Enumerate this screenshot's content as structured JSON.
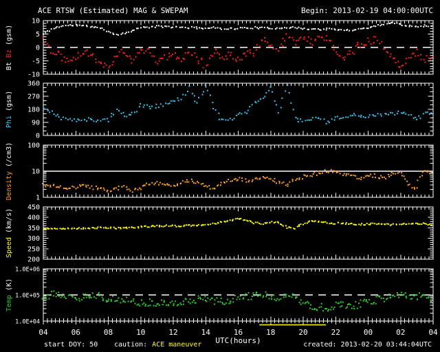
{
  "header": {
    "title": "ACE RTSW (Estimated) MAG & SWEPAM",
    "begin_label": "Begin: 2013-02-19 04:00:00UTC"
  },
  "footer": {
    "xlabel": "UTC(hours)",
    "start_doy": "start DOY: 50",
    "caution_label": "caution:",
    "caution_value": "ACE maneuver",
    "created": "created: 2013-02-20 03:44:04UTC"
  },
  "colors": {
    "background": "#000000",
    "frame": "#ffffff",
    "bt": "#ffffff",
    "bz": "#ff2020",
    "phi": "#38c9f5",
    "density": "#ffa028",
    "speed": "#ffff00",
    "temp": "#2ecc2e",
    "caution": "#ffff00"
  },
  "chart_data": {
    "type": "scatter",
    "title": "ACE RTSW (Estimated) MAG & SWEPAM",
    "begin_utc": "2013-02-19 04:00:00UTC",
    "created_utc": "2013-02-20 03:44:04UTC",
    "xlabel": "UTC(hours)",
    "x_range": [
      4,
      28
    ],
    "x_step": 0.5,
    "x_ticks": [
      {
        "value": 4,
        "label": "04"
      },
      {
        "value": 6,
        "label": "06"
      },
      {
        "value": 8,
        "label": "08"
      },
      {
        "value": 10,
        "label": "10"
      },
      {
        "value": 12,
        "label": "12"
      },
      {
        "value": 14,
        "label": "14"
      },
      {
        "value": 16,
        "label": "16"
      },
      {
        "value": 18,
        "label": "18"
      },
      {
        "value": 20,
        "label": "20"
      },
      {
        "value": 22,
        "label": "22"
      },
      {
        "value": 24,
        "label": "00"
      },
      {
        "value": 26,
        "label": "02"
      },
      {
        "value": 28,
        "label": "04"
      }
    ],
    "maneuver_span_hours": [
      17.3,
      21.4
    ],
    "panels": [
      {
        "id": "mag",
        "axis_label_parts": [
          {
            "text": "Bt",
            "color": "#ffffff"
          },
          {
            "text": "Bz",
            "color": "#ff2020"
          },
          {
            "text": "(gsm)",
            "color": "#ffffff"
          }
        ],
        "scale": "linear",
        "ylim": [
          -10,
          10
        ],
        "yticks": [
          {
            "value": 10,
            "label": "10"
          },
          {
            "value": 5,
            "label": "5"
          },
          {
            "value": 0,
            "label": "0"
          },
          {
            "value": -5,
            "label": "-5"
          },
          {
            "value": -10,
            "label": "-10"
          }
        ],
        "refline": {
          "value": 0,
          "style": "dashed"
        },
        "series": [
          {
            "name": "Bt",
            "color": "#ffffff",
            "seed": 11,
            "points_per_step": 4,
            "jitter_mode": "linear",
            "scatter_amp": 0.35,
            "values": [
              5.0,
              6.8,
              7.8,
              8.2,
              8.3,
              8.0,
              7.8,
              7.2,
              6.0,
              4.8,
              5.2,
              6.5,
              7.3,
              7.6,
              7.8,
              7.8,
              7.6,
              7.5,
              7.4,
              7.3,
              7.2,
              7.3,
              7.1,
              7.0,
              7.1,
              7.3,
              7.4,
              7.2,
              7.1,
              7.3,
              7.5,
              7.3,
              7.1,
              6.9,
              6.7,
              6.9,
              6.6,
              6.4,
              6.6,
              6.9,
              7.4,
              8.0,
              8.8,
              9.2,
              8.6,
              8.1,
              7.9,
              8.1,
              8.0
            ]
          },
          {
            "name": "Bz",
            "color": "#ff2020",
            "seed": 22,
            "points_per_step": 5,
            "jitter_mode": "linear",
            "scatter_amp": 1.4,
            "values": [
              3.5,
              -1.0,
              -2.5,
              -5.0,
              -3.0,
              -1.5,
              -3.0,
              -5.5,
              -6.5,
              -4.0,
              -1.0,
              -5.0,
              -2.0,
              -1.0,
              -6.0,
              -4.0,
              -1.5,
              -5.0,
              -1.0,
              -4.0,
              -7.0,
              -1.5,
              -4.0,
              -2.5,
              -4.0,
              -2.0,
              -2.0,
              3.0,
              1.0,
              -1.0,
              4.0,
              1.5,
              4.0,
              2.0,
              3.0,
              4.0,
              -1.0,
              -3.5,
              -2.0,
              1.0,
              2.5,
              3.0,
              0.0,
              -4.0,
              -7.0,
              -3.5,
              -1.5,
              -4.5,
              -3.5
            ]
          }
        ]
      },
      {
        "id": "phi",
        "axis_label_parts": [
          {
            "text": "Phi",
            "color": "#38c9f5"
          },
          {
            "text": "(gsm)",
            "color": "#ffffff"
          }
        ],
        "scale": "linear",
        "ylim": [
          0,
          360
        ],
        "yticks": [
          {
            "value": 360,
            "label": "360"
          },
          {
            "value": 270,
            "label": "270"
          },
          {
            "value": 180,
            "label": "180"
          },
          {
            "value": 90,
            "label": "90"
          },
          {
            "value": 0,
            "label": "0"
          }
        ],
        "refline": null,
        "series": [
          {
            "name": "Phi",
            "color": "#38c9f5",
            "seed": 33,
            "points_per_step": 4,
            "jitter_mode": "linear",
            "scatter_amp": 14,
            "values": [
              185,
              160,
              125,
              108,
              100,
              108,
              112,
              103,
              108,
              172,
              140,
              148,
              205,
              195,
              200,
              215,
              240,
              250,
              330,
              215,
              345,
              195,
              100,
              108,
              145,
              155,
              230,
              250,
              340,
              155,
              350,
              115,
              95,
              108,
              118,
              85,
              115,
              128,
              135,
              140,
              130,
              140,
              148,
              152,
              158,
              150,
              112,
              145,
              152
            ]
          }
        ]
      },
      {
        "id": "density",
        "axis_label_parts": [
          {
            "text": "Density",
            "color": "#ffa028"
          },
          {
            "text": "(/cm3)",
            "color": "#ffffff"
          }
        ],
        "scale": "log",
        "ylim": [
          1,
          100
        ],
        "yticks": [
          {
            "value": 100,
            "label": "100"
          },
          {
            "value": 10,
            "label": "10"
          },
          {
            "value": 1,
            "label": "1"
          }
        ],
        "refline": {
          "value": 10,
          "style": "solid"
        },
        "series": [
          {
            "name": "Density",
            "color": "#ffa028",
            "seed": 44,
            "points_per_step": 5,
            "jitter_mode": "log",
            "scatter_amp": 0.07,
            "values": [
              3.0,
              2.7,
              2.4,
              2.2,
              2.5,
              2.8,
              2.4,
              2.1,
              1.8,
              2.1,
              2.6,
              1.7,
              2.3,
              3.1,
              3.6,
              3.0,
              2.6,
              4.0,
              4.4,
              3.4,
              2.6,
              2.1,
              3.6,
              4.6,
              5.2,
              4.2,
              4.6,
              5.6,
              5.0,
              3.6,
              3.1,
              4.6,
              6.2,
              7.2,
              8.8,
              10.5,
              9.2,
              7.6,
              6.6,
              5.6,
              7.2,
              6.6,
              5.6,
              7.6,
              8.2,
              3.1,
              2.1,
              11.0,
              8.2
            ]
          }
        ]
      },
      {
        "id": "speed",
        "axis_label_parts": [
          {
            "text": "Speed",
            "color": "#ffff00"
          },
          {
            "text": "(km/s)",
            "color": "#ffffff"
          }
        ],
        "scale": "linear",
        "ylim": [
          200,
          450
        ],
        "yticks": [
          {
            "value": 450,
            "label": "450"
          },
          {
            "value": 400,
            "label": "400"
          },
          {
            "value": 350,
            "label": "350"
          },
          {
            "value": 300,
            "label": "300"
          },
          {
            "value": 250,
            "label": "250"
          },
          {
            "value": 200,
            "label": "200"
          }
        ],
        "refline": null,
        "series": [
          {
            "name": "Speed",
            "color": "#ffff00",
            "seed": 55,
            "points_per_step": 5,
            "jitter_mode": "linear",
            "scatter_amp": 4,
            "values": [
              345,
              346,
              348,
              347,
              346,
              348,
              350,
              351,
              350,
              349,
              350,
              352,
              354,
              356,
              358,
              360,
              359,
              358,
              361,
              364,
              367,
              371,
              377,
              386,
              396,
              384,
              374,
              369,
              379,
              374,
              352,
              349,
              369,
              383,
              379,
              374,
              372,
              371,
              369,
              366,
              368,
              369,
              367,
              365,
              367,
              369,
              371,
              369,
              364
            ]
          }
        ]
      },
      {
        "id": "temp",
        "axis_label_parts": [
          {
            "text": "Temp",
            "color": "#2ecc2e"
          },
          {
            "text": "(K)",
            "color": "#ffffff"
          }
        ],
        "scale": "log",
        "ylim": [
          10000,
          1000000
        ],
        "yticks": [
          {
            "value": 1000000,
            "label": "1.0E+06"
          },
          {
            "value": 100000,
            "label": "1.0E+05"
          },
          {
            "value": 10000,
            "label": "1.0E+04"
          }
        ],
        "refline": {
          "value": 100000,
          "style": "dashed"
        },
        "series": [
          {
            "name": "Temp",
            "color": "#2ecc2e",
            "seed": 66,
            "points_per_step": 6,
            "jitter_mode": "log",
            "scatter_amp": 0.14,
            "values": [
              90000,
              100000,
              110000,
              92000,
              76000,
              82000,
              105000,
              90000,
              70000,
              64000,
              60000,
              56000,
              50000,
              52000,
              48000,
              45000,
              50000,
              56000,
              60000,
              66000,
              70000,
              60000,
              55000,
              66000,
              76000,
              86000,
              96000,
              110000,
              90000,
              76000,
              105000,
              80000,
              50000,
              40000,
              35000,
              32000,
              38000,
              42000,
              35000,
              45000,
              55000,
              65000,
              75000,
              90000,
              100000,
              85000,
              95000,
              75000,
              65000
            ]
          }
        ]
      }
    ]
  }
}
